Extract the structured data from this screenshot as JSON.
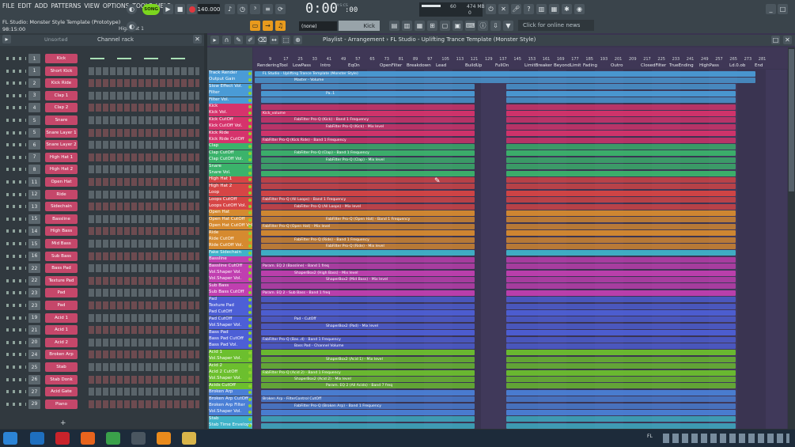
{
  "menu": [
    "FILE",
    "EDIT",
    "ADD",
    "PATTERNS",
    "VIEW",
    "OPTIONS",
    "TOOLS",
    "HELP"
  ],
  "window_title": "FL Studio: Monster Style Template (Prototype)",
  "time_readout": "98:15:00",
  "hint_channel": "High Hat 1",
  "transport": {
    "mode": "SONG",
    "tempo": "140.000",
    "clock": "0:00",
    "clock_decimal": ":00",
    "clock_unit": "M:S:CS"
  },
  "cpu": {
    "value": "60",
    "memory": "474 MB",
    "zero": "0"
  },
  "pattern_selector": "(none)",
  "channel_selector": "Kick",
  "online_news": "Click for online news",
  "channel_rack": {
    "filter": "Unsorted",
    "title": "Channel rack",
    "channels": [
      {
        "num": "1",
        "name": "Kick",
        "color": "#c5476a"
      },
      {
        "num": "1",
        "name": "Short Kick",
        "color": "#c5476a"
      },
      {
        "num": "2",
        "name": "Kick Ride",
        "color": "#c5476a"
      },
      {
        "num": "3",
        "name": "Clap 1",
        "color": "#c5476a"
      },
      {
        "num": "4",
        "name": "Clap 2",
        "color": "#c5476a"
      },
      {
        "num": "5",
        "name": "Snare",
        "color": "#c5476a"
      },
      {
        "num": "5",
        "name": "Snare Layer 1",
        "color": "#c5476a"
      },
      {
        "num": "6",
        "name": "Snare Layer 2",
        "color": "#c5476a"
      },
      {
        "num": "7",
        "name": "High Hat 1",
        "color": "#c5476a"
      },
      {
        "num": "8",
        "name": "High Hat 2",
        "color": "#c5476a"
      },
      {
        "num": "11",
        "name": "Open Hat",
        "color": "#c5476a"
      },
      {
        "num": "12",
        "name": "Ride",
        "color": "#c5476a"
      },
      {
        "num": "13",
        "name": "Sidechain",
        "color": "#c5476a"
      },
      {
        "num": "15",
        "name": "Bassline",
        "color": "#c5476a"
      },
      {
        "num": "14",
        "name": "High Bass",
        "color": "#c5476a"
      },
      {
        "num": "15",
        "name": "Mid Bass",
        "color": "#c5476a"
      },
      {
        "num": "16",
        "name": "Sub Bass",
        "color": "#c5476a"
      },
      {
        "num": "22",
        "name": "Bass Pad",
        "color": "#c5476a"
      },
      {
        "num": "22",
        "name": "Texture Pad",
        "color": "#c5476a"
      },
      {
        "num": "23",
        "name": "Pad",
        "color": "#c5476a"
      },
      {
        "num": "23",
        "name": "Pad",
        "color": "#c5476a"
      },
      {
        "num": "19",
        "name": "Acid 1",
        "color": "#c5476a"
      },
      {
        "num": "21",
        "name": "Acid 1",
        "color": "#c5476a"
      },
      {
        "num": "20",
        "name": "Acid 2",
        "color": "#c5476a"
      },
      {
        "num": "24",
        "name": "Broken Arp",
        "color": "#c5476a"
      },
      {
        "num": "25",
        "name": "Stab",
        "color": "#c5476a"
      },
      {
        "num": "26",
        "name": "Stab Donk",
        "color": "#c5476a"
      },
      {
        "num": "27",
        "name": "Acid Gate",
        "color": "#c5476a"
      },
      {
        "num": "29",
        "name": "Piano",
        "color": "#c5476a"
      }
    ]
  },
  "playlist": {
    "title": "Playlist - Arrangement",
    "project": "FL Studio - Uplifting Trance Template (Monster Style)",
    "bar_numbers": [
      "9",
      "17",
      "25",
      "33",
      "41",
      "49",
      "57",
      "65",
      "73",
      "81",
      "89",
      "97",
      "105",
      "113",
      "121",
      "129",
      "137",
      "145",
      "153",
      "161",
      "169",
      "177",
      "185",
      "193",
      "201",
      "209",
      "217",
      "225",
      "233",
      "241",
      "249",
      "257",
      "265",
      "273",
      "281"
    ],
    "markers": [
      "RenderingTool",
      "LowPass",
      "Intro",
      "EqOn",
      "OpenFilter",
      "Breakdown",
      "Lead",
      "BuildUp",
      "FullOn",
      "LimitBreaker",
      "BeyondLimit",
      "Fading",
      "Outro",
      "ClosedFilter",
      "TrueEnding",
      "HighPass",
      "Ld.0.ob",
      "End"
    ],
    "tracks": [
      {
        "name": "Track Render",
        "color": "#4a9bd6"
      },
      {
        "name": "Output Gain",
        "color": "#4a9bd6"
      },
      {
        "name": "Slow Effect Vol.",
        "color": "#4a9bd6"
      },
      {
        "name": "Filter",
        "color": "#4a9bd6"
      },
      {
        "name": "Filter Vol.",
        "color": "#4a9bd6"
      },
      {
        "name": "Kick",
        "color": "#d6336c"
      },
      {
        "name": "Kick Vol.",
        "color": "#d6336c"
      },
      {
        "name": "Kick CutOff",
        "color": "#d6336c"
      },
      {
        "name": "Kick CutOff Vol.",
        "color": "#d6336c"
      },
      {
        "name": "Kick Ride",
        "color": "#d6336c"
      },
      {
        "name": "Kick Ride CutOff",
        "color": "#d6336c"
      },
      {
        "name": "Clap",
        "color": "#3bb36b"
      },
      {
        "name": "Clap CutOff",
        "color": "#3bb36b"
      },
      {
        "name": "Clap CutOff Vol.",
        "color": "#3bb36b"
      },
      {
        "name": "Snare",
        "color": "#3bb36b"
      },
      {
        "name": "Snare Vol.",
        "color": "#3bb36b"
      },
      {
        "name": "High Hat 1",
        "color": "#d64545"
      },
      {
        "name": "High Hat 2",
        "color": "#d64545"
      },
      {
        "name": "Loop",
        "color": "#d64545"
      },
      {
        "name": "Loops CutOff",
        "color": "#d64545"
      },
      {
        "name": "Loops CutOff Vol.",
        "color": "#d64545"
      },
      {
        "name": "Open Hat",
        "color": "#d68a2f"
      },
      {
        "name": "Open Hat CutOff",
        "color": "#d68a2f"
      },
      {
        "name": "Open Hat CutOff Vol",
        "color": "#d68a2f"
      },
      {
        "name": "Ride",
        "color": "#d68a2f"
      },
      {
        "name": "Ride CutOff",
        "color": "#d68a2f"
      },
      {
        "name": "Ride CutOff Vol.",
        "color": "#d68a2f"
      },
      {
        "name": "Fake Sidechain",
        "color": "#3fb3c9"
      },
      {
        "name": "Bassline",
        "color": "#c03fb0"
      },
      {
        "name": "Bassline CutOff",
        "color": "#c03fb0"
      },
      {
        "name": "Vol.Shaper Vol.",
        "color": "#c03fb0"
      },
      {
        "name": "Vol.Shaper Vol.",
        "color": "#c03fb0"
      },
      {
        "name": "Sub Bass",
        "color": "#c03fb0"
      },
      {
        "name": "Sub Bass CutOff",
        "color": "#c03fb0"
      },
      {
        "name": "Pad",
        "color": "#4d5fd6"
      },
      {
        "name": "Texture Pad",
        "color": "#4d5fd6"
      },
      {
        "name": "Pad CutOff",
        "color": "#4d5fd6"
      },
      {
        "name": "Pad CutOff",
        "color": "#4d5fd6"
      },
      {
        "name": "Vol.Shaper Vol.",
        "color": "#4d5fd6"
      },
      {
        "name": "Bass Pad",
        "color": "#4d5fd6"
      },
      {
        "name": "Bass Pad CutOff",
        "color": "#4d5fd6"
      },
      {
        "name": "Bass Pad Vol.",
        "color": "#4d5fd6"
      },
      {
        "name": "Acid 1",
        "color": "#6cbf2e"
      },
      {
        "name": "Vol.Shaper Vol.",
        "color": "#6cbf2e"
      },
      {
        "name": "Acid 2",
        "color": "#6cbf2e"
      },
      {
        "name": "Acid 2 CutOff",
        "color": "#6cbf2e"
      },
      {
        "name": "Vol.Shaper Vol.",
        "color": "#6cbf2e"
      },
      {
        "name": "Acids CutOff",
        "color": "#6cbf2e"
      },
      {
        "name": "Broken Arp",
        "color": "#4a7fd6"
      },
      {
        "name": "Broken Arp CutOff",
        "color": "#4a7fd6"
      },
      {
        "name": "Broken Arp Filter",
        "color": "#4a7fd6"
      },
      {
        "name": "Vol.Shaper Vol.",
        "color": "#4a7fd6"
      },
      {
        "name": "Stab",
        "color": "#3fb3c9"
      },
      {
        "name": "Stab Time Envelope",
        "color": "#3fb3c9"
      }
    ],
    "clip_labels": [
      "FL Studio - Uplifting Trance Template (Monster Style)",
      "Master - Volume",
      "Pa..1",
      "Kick_volume",
      "FabFilter Pro-Q (Kick) - Band 1 Frequency",
      "FabFilter Pro-Q (Kick) - Mix level",
      "FabFilter Pro-Q (Kick Ride) - Band 1 Frequency",
      "FabFilter Pro-Q (Clap) - Band 1 Frequency",
      "FabFilter Pro-Q (Clap) - Mix level",
      "FabFilter Pro-Q (All Loops) - Band 1 Frequency",
      "FabFilter Pro-Q (All Loops) - Mix level",
      "FabFilter Pro-Q (Open Hat) - Band 1 Frequency",
      "FabFilter Pro-Q (Open Hat) - Mix level",
      "FabFilter Pro-Q (Ride) - Band 1 Frequency",
      "FabFilter Pro-Q (Ride) - Mix level",
      "Param. EQ 2 (Bassline) - Band 1 freq",
      "ShaperBox2 (High Bass) - Mix level",
      "ShaperBox2 (Mid Bass) - Mix level",
      "Param. EQ 2 - Sub Bass - Band 1 freq",
      "Pad - CutOff",
      "ShaperBox2 (Pad) - Mix level",
      "FabFilter Pro-Q (Bas..d) - Band 1 Frequency",
      "Bass Pad - Channel Volume",
      "ShaperBox2 (Acid 1) - Mix level",
      "FabFilter Pro-Q (Acid 2) - Band 1 Frequency",
      "ShaperBox2 (Acid 2) - Mix level",
      "Param. EQ 2 (All Acids) - Band 7 freq",
      "Broken Arp - FilterControl CutOff",
      "FabFilter Pro-Q (Broken Arp) - Band 1 Frequency"
    ]
  },
  "taskbar": {
    "tray_lang": "FL"
  }
}
